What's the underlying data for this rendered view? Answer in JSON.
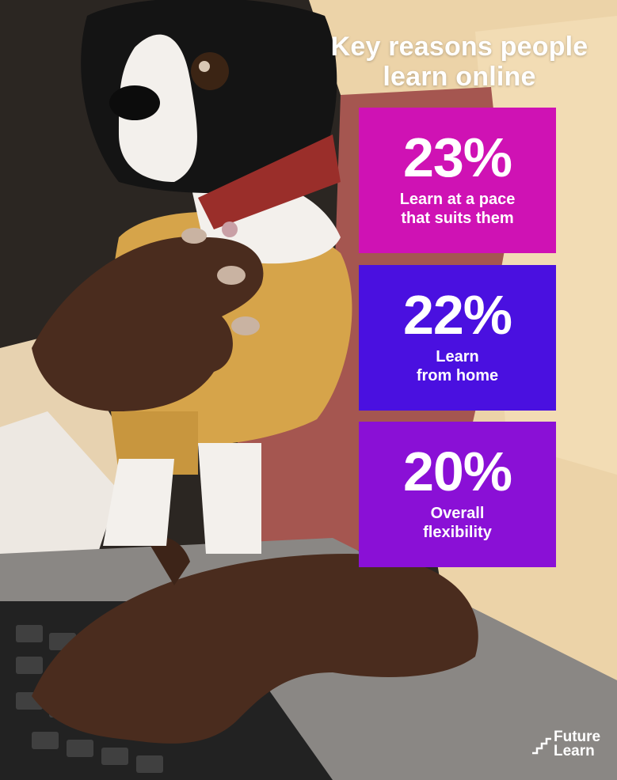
{
  "infographic": {
    "title": "Key reasons people learn online",
    "stats": [
      {
        "value": "23%",
        "label": "Learn at a pace\nthat suits them",
        "color": "#cf12b4"
      },
      {
        "value": "22%",
        "label": "Learn\nfrom home",
        "color": "#4a10e0"
      },
      {
        "value": "20%",
        "label": "Overall\nflexibility",
        "color": "#8a10d6"
      }
    ]
  },
  "brand": {
    "line1": "Future",
    "line2": "Learn",
    "icon": "stairs-logo-icon"
  },
  "background": {
    "subject": "photo-background"
  }
}
